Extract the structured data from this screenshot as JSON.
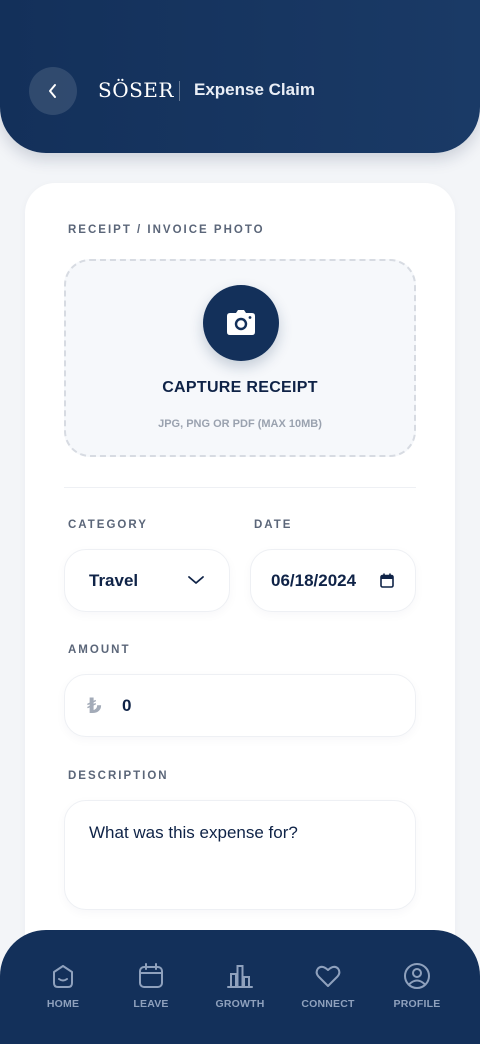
{
  "header": {
    "logo_text": "SÖSER",
    "title": "Expense Claim",
    "back_icon": "chevron-left-icon"
  },
  "receipt": {
    "section_label": "RECEIPT / INVOICE PHOTO",
    "capture_title": "CAPTURE RECEIPT",
    "capture_hint": "JPG, PNG OR PDF (MAX 10MB)",
    "icon": "camera-icon"
  },
  "category": {
    "label": "CATEGORY",
    "value": "Travel",
    "icon": "chevron-down-icon"
  },
  "date": {
    "label": "DATE",
    "value": "06/18/2024",
    "icon": "calendar-icon"
  },
  "amount": {
    "label": "AMOUNT",
    "currency_symbol": "₺",
    "value": "0"
  },
  "description": {
    "label": "DESCRIPTION",
    "placeholder": "What was this expense for?"
  },
  "nav": {
    "items": [
      {
        "label": "HOME",
        "icon": "home-icon"
      },
      {
        "label": "LEAVE",
        "icon": "calendar-icon"
      },
      {
        "label": "GROWTH",
        "icon": "bar-chart-icon"
      },
      {
        "label": "CONNECT",
        "icon": "heart-icon"
      },
      {
        "label": "PROFILE",
        "icon": "user-icon"
      }
    ]
  },
  "colors": {
    "primary": "#13305a",
    "background": "#f3f5f8",
    "card": "#ffffff",
    "muted_text": "#5b6679",
    "nav_label": "#8fa1bd"
  }
}
